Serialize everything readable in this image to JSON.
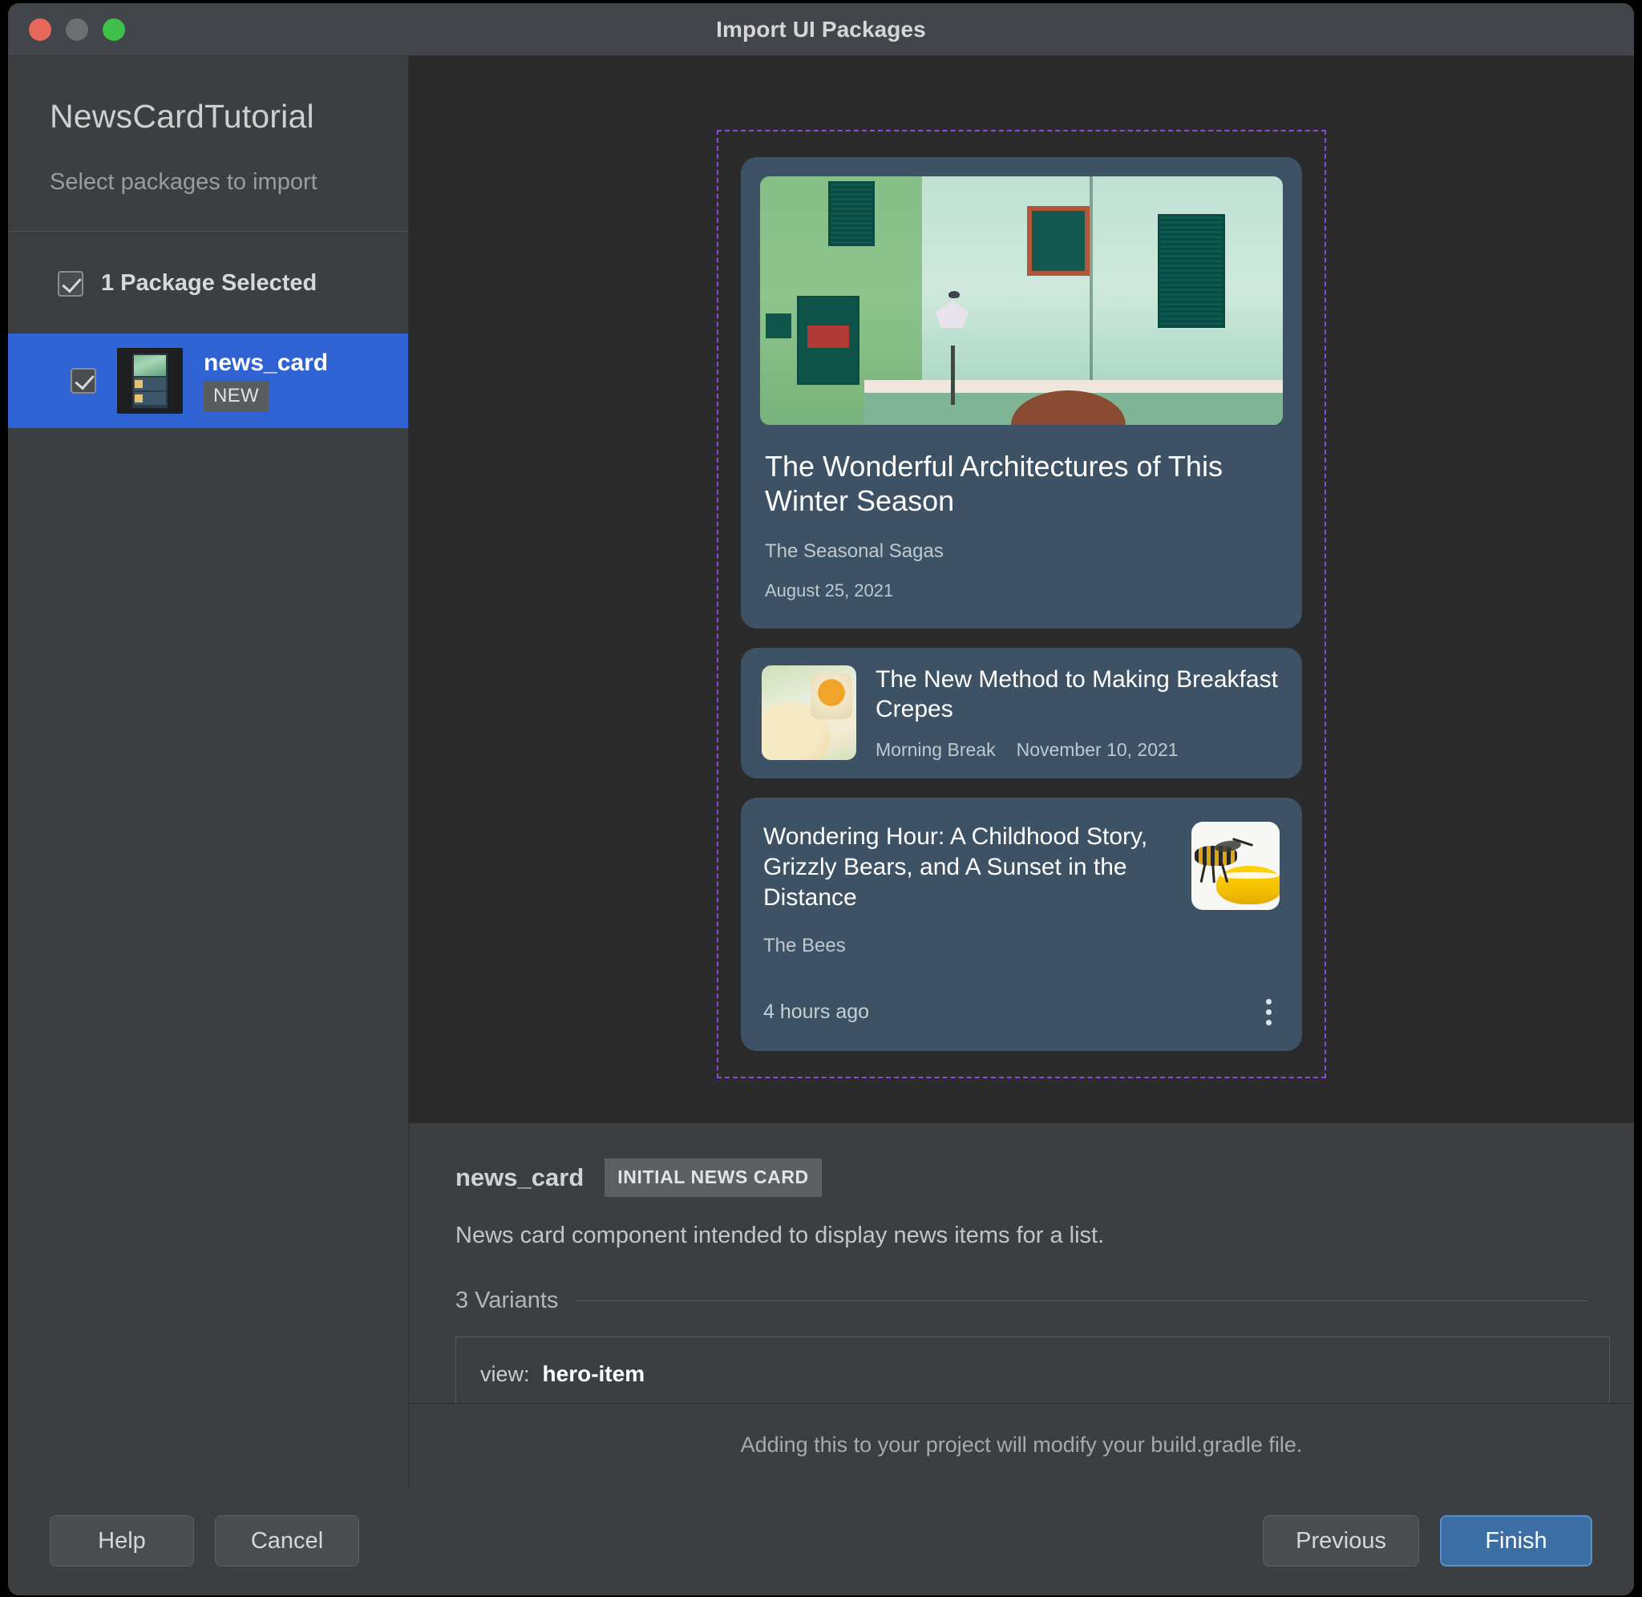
{
  "window": {
    "title": "Import UI Packages",
    "traffic_lights": [
      "close",
      "minimize",
      "zoom"
    ]
  },
  "sidebar": {
    "project_name": "NewsCardTutorial",
    "subtitle": "Select packages to import",
    "select_all": {
      "label": "1 Package Selected",
      "checked": true
    },
    "packages": [
      {
        "name": "news_card",
        "badge": "NEW",
        "checked": true,
        "selected": true
      }
    ]
  },
  "preview": {
    "cards": [
      {
        "variant": "hero",
        "title": "The Wonderful Architectures of This Winter Season",
        "source": "The Seasonal Sagas",
        "date": "August 25, 2021",
        "image_alt": "green-building-facade-photo"
      },
      {
        "variant": "listing",
        "title": "The New Method to Making Breakfast Crepes",
        "source": "Morning Break",
        "date": "November 10, 2021",
        "image_alt": "breakfast-crepes-photo"
      },
      {
        "variant": "listing-reversed",
        "title": "Wondering Hour: A Childhood Story, Grizzly Bears, and A Sunset in the Distance",
        "source": "The Bees",
        "date": "4 hours ago",
        "image_alt": "bee-on-lemon-photo",
        "overflow_icon": "kebab-menu-icon"
      }
    ]
  },
  "detail": {
    "name": "news_card",
    "tag": "INITIAL NEWS CARD",
    "description": "News card component intended to display news items for a list.",
    "variants_label": "3 Variants",
    "variants": [
      {
        "key": "view:",
        "value": "hero-item"
      }
    ]
  },
  "footer": {
    "note": "Adding this to your project will modify your build.gradle file."
  },
  "buttons": {
    "help": "Help",
    "cancel": "Cancel",
    "previous": "Previous",
    "finish": "Finish"
  },
  "colors": {
    "window_bg": "#3c3f41",
    "titlebar_bg": "#42464a",
    "preview_bg": "#2b2b2b",
    "selection_blue": "#2f63d4",
    "primary_button": "#3b6ea5",
    "dashed_frame": "#8a4bdb",
    "card_bg": "#3d5265"
  }
}
